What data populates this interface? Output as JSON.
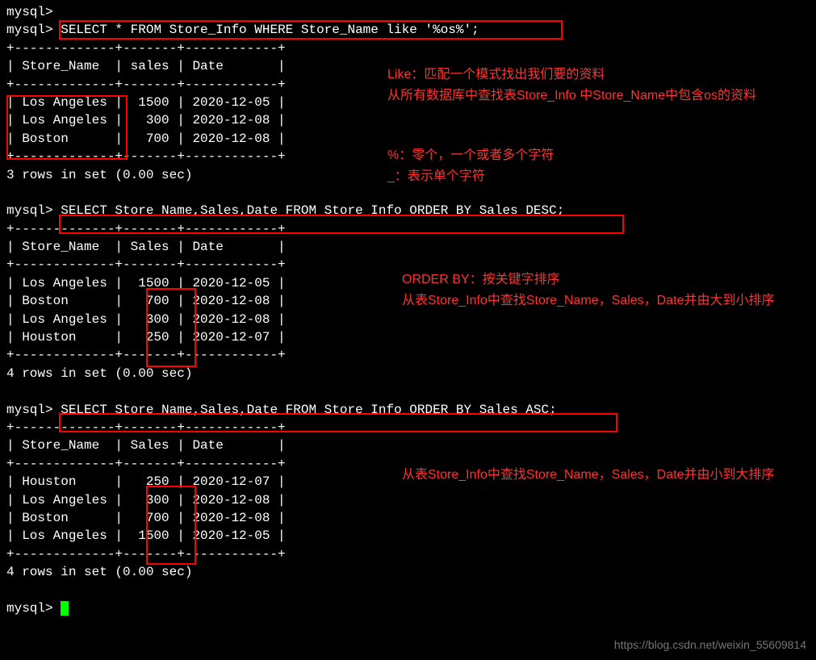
{
  "prompts": {
    "p0": "mysql>",
    "p1": "mysql>",
    "q1": "SELECT * FROM Store_Info WHERE Store_Name like '%os%';",
    "p2": "mysql>",
    "q2": "SELECT Store_Name,Sales,Date FROM Store_Info ORDER BY Sales DESC;",
    "p3": "mysql>",
    "q3": "SELECT Store_Name,Sales,Date FROM Store_Info ORDER BY Sales ASC;",
    "p_end": "mysql>"
  },
  "table1": {
    "border_top": "+-------------+-------+------------+",
    "header": "| Store_Name  | sales | Date       |",
    "border_mid": "+-------------+-------+------------+",
    "rows": [
      "| Los Angeles |  1500 | 2020-12-05 |",
      "| Los Angeles |   300 | 2020-12-08 |",
      "| Boston      |   700 | 2020-12-08 |"
    ],
    "border_bot": "+-------------+-------+------------+",
    "footer": "3 rows in set (0.00 sec)"
  },
  "table2": {
    "border_top": "+-------------+-------+------------+",
    "header": "| Store_Name  | Sales | Date       |",
    "border_mid": "+-------------+-------+------------+",
    "rows": [
      "| Los Angeles |  1500 | 2020-12-05 |",
      "| Boston      |   700 | 2020-12-08 |",
      "| Los Angeles |   300 | 2020-12-08 |",
      "| Houston     |   250 | 2020-12-07 |"
    ],
    "border_bot": "+-------------+-------+------------+",
    "footer": "4 rows in set (0.00 sec)"
  },
  "table3": {
    "border_top": "+-------------+-------+------------+",
    "header": "| Store_Name  | Sales | Date       |",
    "border_mid": "+-------------+-------+------------+",
    "rows": [
      "| Houston     |   250 | 2020-12-07 |",
      "| Los Angeles |   300 | 2020-12-08 |",
      "| Boston      |   700 | 2020-12-08 |",
      "| Los Angeles |  1500 | 2020-12-05 |"
    ],
    "border_bot": "+-------------+-------+------------+",
    "footer": "4 rows in set (0.00 sec)"
  },
  "annotations": {
    "a1": "Like：匹配一个模式找出我们要的资料\n从所有数据库中查找表Store_Info 中Store_Name中包含os的资料",
    "a2": "%：零个，一个或者多个字符\n_：表示单个字符",
    "a3": "ORDER BY：按关键字排序\n从表Store_Info中查找Store_Name，Sales，Date并由大到小排序",
    "a4": "从表Store_Info中查找Store_Name，Sales，Date并由小到大排序"
  },
  "watermark": "https://blog.csdn.net/weixin_55609814"
}
